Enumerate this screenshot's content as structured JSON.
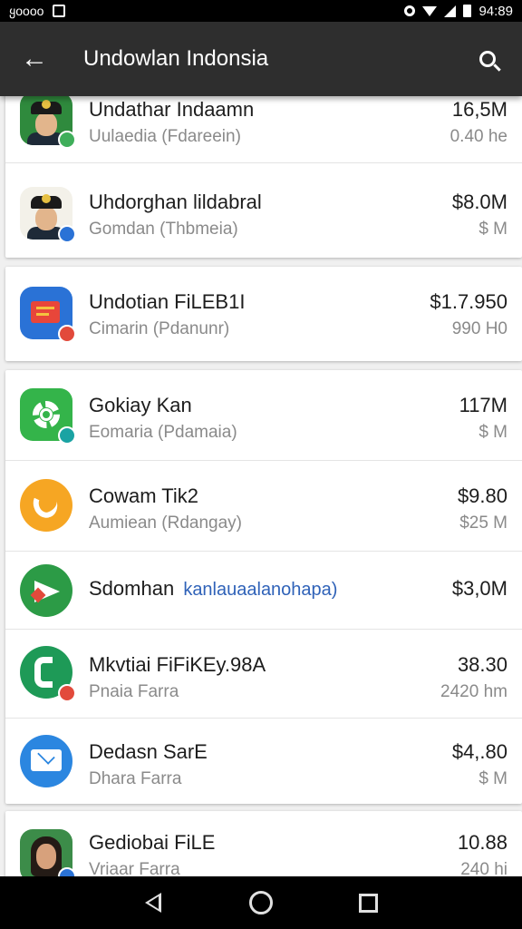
{
  "status_bar": {
    "carrier": "ყoooo",
    "time": "94:89",
    "icons": [
      "notification-icon",
      "location-icon",
      "wifi-icon",
      "signal-icon",
      "battery-icon"
    ]
  },
  "app_bar": {
    "title": "Undowlan Indonsia",
    "back_icon": "arrow-left-icon",
    "search_icon": "search-icon"
  },
  "items": [
    {
      "title": "Undathar Indaamn",
      "subtitle": "Uulaedia (Fdareein)",
      "price": "16,5M",
      "size": "0.40 he",
      "icon": "officer-avatar-icon"
    },
    {
      "title": "Uhdorghan lildabral",
      "subtitle": "Gomdan (Thbmeia)",
      "price": "$8.0M",
      "size": "$ M",
      "icon": "officer-avatar-icon"
    },
    {
      "title": "Undotian FiLEB1I",
      "subtitle": "Cimarin (Pdanunr)",
      "price": "$1.7.950",
      "size": "990 H0",
      "icon": "file-app-icon"
    },
    {
      "title": "Gokiay Kan",
      "subtitle": "Eomaria (Pdamaia)",
      "price": "117M",
      "size": "$ M",
      "icon": "gear-app-icon"
    },
    {
      "title": "Cowam Tik2",
      "subtitle": "Aumiean (Rdangay)",
      "price": "$9.80",
      "size": "$25 M",
      "icon": "phone-app-icon"
    },
    {
      "title": "Sdomhan",
      "subtitle": "kanlauaalanohapa)",
      "price": "$3,0M",
      "size": "",
      "icon": "play-app-icon"
    },
    {
      "title": "Mkvtiai FiFiKEy.98A",
      "subtitle": "Pnaia Farra",
      "price": "38.30",
      "size": "2420 hm",
      "icon": "call-app-icon"
    },
    {
      "title": "Dedasn SarE",
      "subtitle": "Dhara Farra",
      "price": "$4,.80",
      "size": "$ M",
      "icon": "mail-app-icon"
    },
    {
      "title": "Gediobai FiLE",
      "subtitle": "Vriaar Farra",
      "price": "10.88",
      "size": "240 hi",
      "icon": "woman-avatar-icon"
    }
  ],
  "badge_colors": [
    "#3fae5a",
    "#2a72d6",
    "#e24a3b",
    "#1aa3a3",
    "#e24a3b",
    "#2a72d6",
    "#3fae5a"
  ],
  "nav_bar": {
    "icons": [
      "nav-back-icon",
      "nav-home-icon",
      "nav-recent-icon"
    ]
  }
}
